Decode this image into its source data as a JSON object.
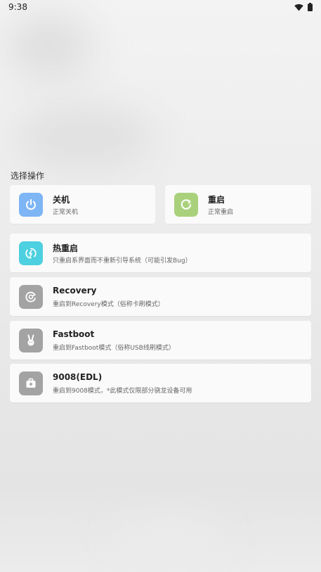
{
  "status_bar": {
    "time": "9:38",
    "icons": [
      "wifi-icon",
      "battery-icon"
    ]
  },
  "section_title": "选择操作",
  "options": {
    "poweroff": {
      "title": "关机",
      "subtitle": "正常关机",
      "icon": "power-icon",
      "color": "#7db5f5"
    },
    "reboot": {
      "title": "重启",
      "subtitle": "正常重启",
      "icon": "restart-icon",
      "color": "#a9d17c"
    },
    "hot_reboot": {
      "title": "热重启",
      "subtitle": "只重启系界面而不重新引导系统（可能引发Bug）",
      "icon": "hot-reboot-icon",
      "color": "#4dd0df"
    },
    "recovery": {
      "title": "Recovery",
      "subtitle": "重启到Recovery模式（俗称卡刷模式）",
      "icon": "recovery-icon",
      "color": "#a3a3a3"
    },
    "fastboot": {
      "title": "Fastboot",
      "subtitle": "重启到Fastboot模式（俗称USB线刷模式）",
      "icon": "fastboot-bunny-icon",
      "color": "#a3a3a3"
    },
    "edl": {
      "title": "9008(EDL)",
      "subtitle": "重启到9008模式，*此模式仅限部分骁龙设备可用",
      "icon": "toolbox-icon",
      "color": "#a3a3a3"
    }
  }
}
